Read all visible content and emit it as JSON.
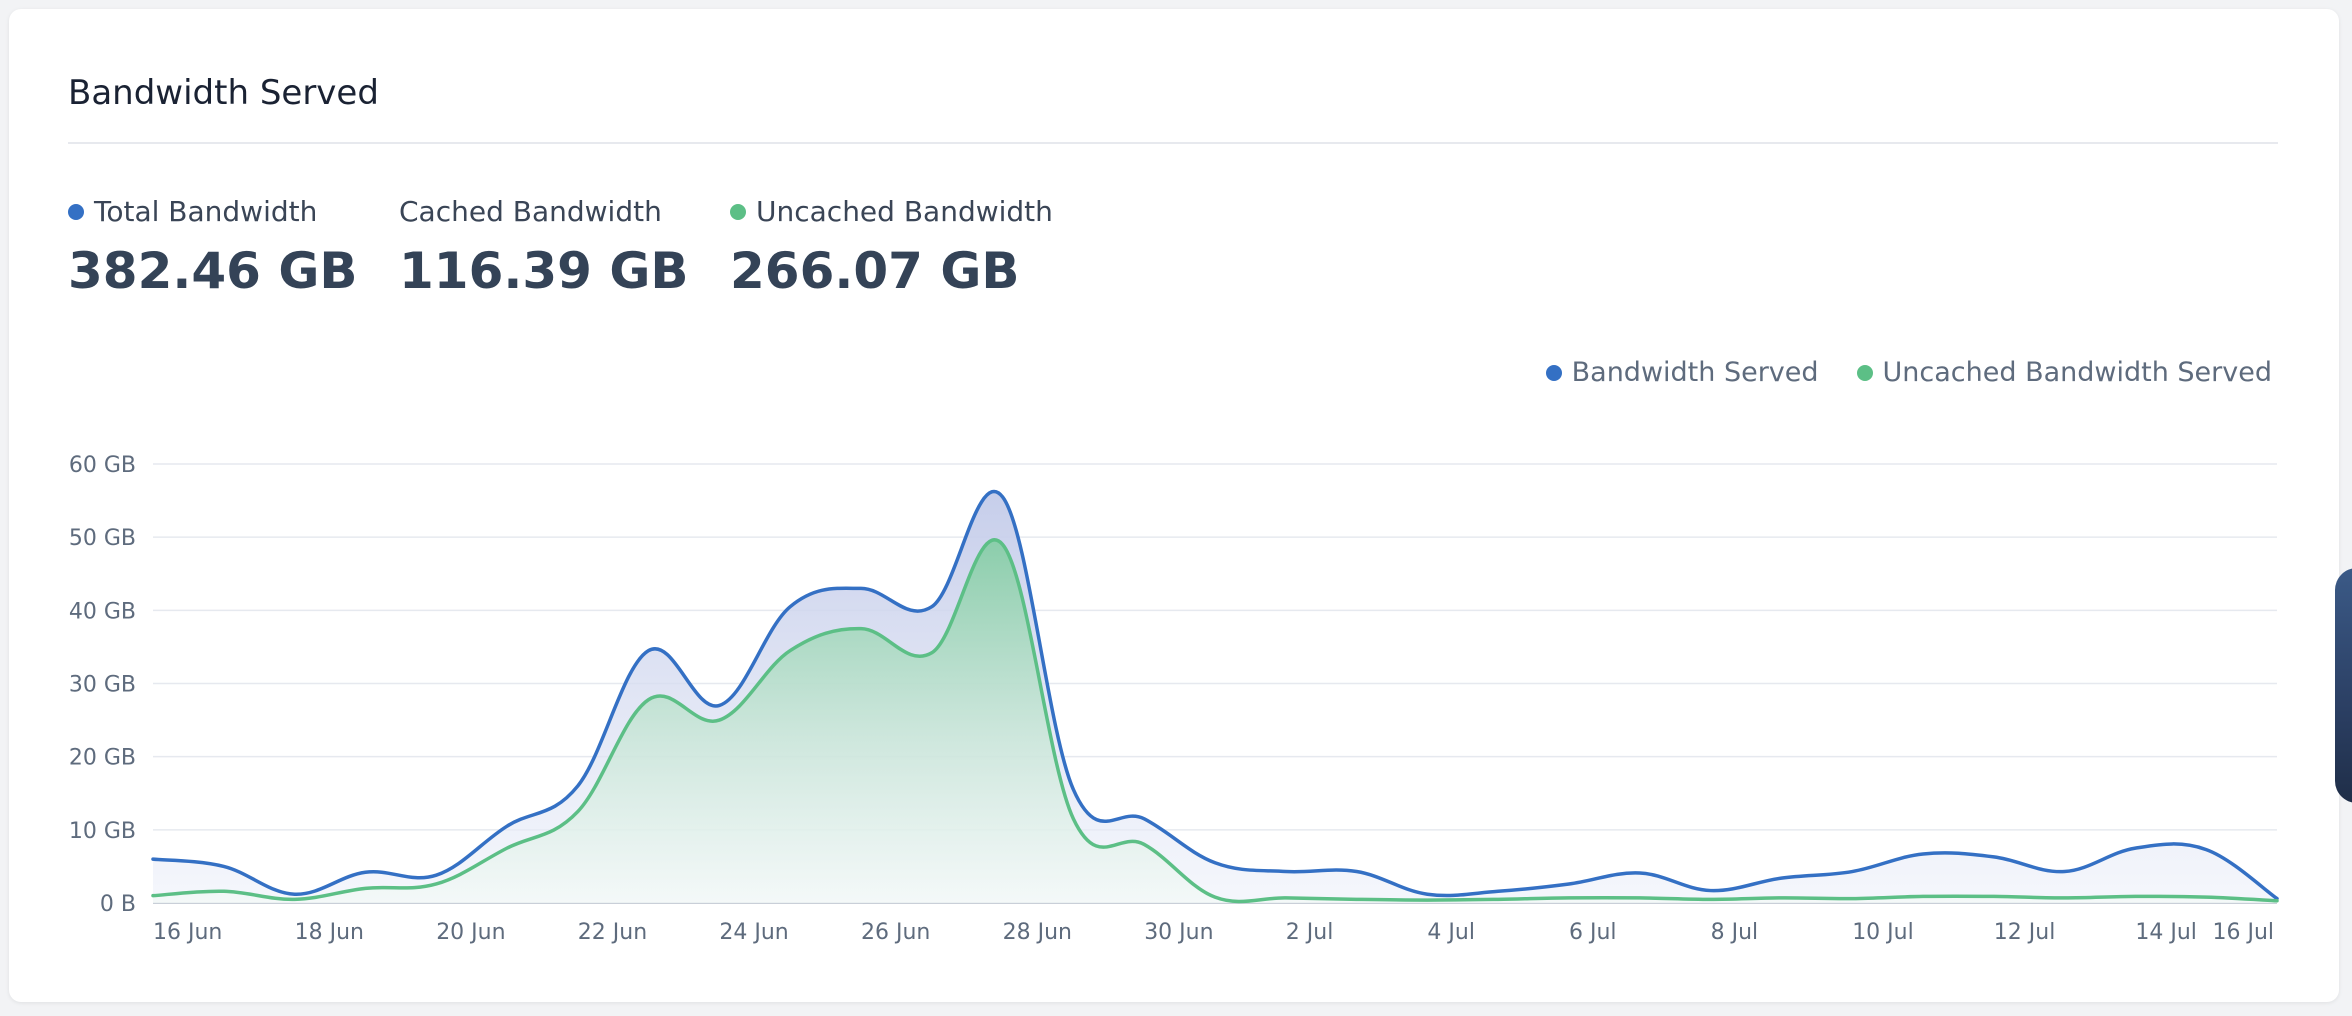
{
  "card": {
    "title": "Bandwidth Served"
  },
  "stats": [
    {
      "label": "Total Bandwidth",
      "value": "382.46 GB",
      "dot_color": "#3470c4",
      "has_dot": true
    },
    {
      "label": "Cached Bandwidth",
      "value": "116.39 GB",
      "dot_color": "",
      "has_dot": false
    },
    {
      "label": "Uncached Bandwidth",
      "value": "266.07 GB",
      "dot_color": "#5cbf86",
      "has_dot": true
    }
  ],
  "legend": [
    {
      "label": "Bandwidth Served",
      "color": "#3470c4"
    },
    {
      "label": "Uncached Bandwidth Served",
      "color": "#5cbf86"
    }
  ],
  "colors": {
    "total_line": "#3470c4",
    "uncached_line": "#5cbf86",
    "total_fill": "#c9d1ec",
    "uncached_fill": "#5cbf86"
  },
  "chart_data": {
    "type": "area",
    "title": "Bandwidth Served",
    "xlabel": "",
    "ylabel": "",
    "ylim": [
      0,
      60
    ],
    "y_unit": "GB",
    "y_ticks": [
      {
        "value": 0,
        "label": "0 B"
      },
      {
        "value": 10,
        "label": "10 GB"
      },
      {
        "value": 20,
        "label": "20 GB"
      },
      {
        "value": 30,
        "label": "30 GB"
      },
      {
        "value": 40,
        "label": "40 GB"
      },
      {
        "value": 50,
        "label": "50 GB"
      },
      {
        "value": 60,
        "label": "60 GB"
      }
    ],
    "x": [
      "16 Jun",
      "17 Jun",
      "18 Jun",
      "19 Jun",
      "20 Jun",
      "21 Jun",
      "22 Jun",
      "23 Jun",
      "24 Jun",
      "25 Jun",
      "26 Jun",
      "27 Jun",
      "28 Jun",
      "29 Jun",
      "30 Jun",
      "1 Jul",
      "2 Jul",
      "3 Jul",
      "4 Jul",
      "5 Jul",
      "6 Jul",
      "7 Jul",
      "8 Jul",
      "9 Jul",
      "10 Jul",
      "11 Jul",
      "12 Jul",
      "13 Jul",
      "14 Jul",
      "15 Jul",
      "16 Jul"
    ],
    "x_tick_labels": [
      "16 Jun",
      "18 Jun",
      "20 Jun",
      "22 Jun",
      "24 Jun",
      "26 Jun",
      "28 Jun",
      "30 Jun",
      "2 Jul",
      "4 Jul",
      "6 Jul",
      "8 Jul",
      "10 Jul",
      "12 Jul",
      "14 Jul",
      "16 Jul"
    ],
    "grid": true,
    "legend_position": "top-right",
    "series": [
      {
        "name": "Bandwidth Served",
        "values": [
          6.0,
          5.0,
          1.2,
          4.2,
          3.8,
          10.5,
          16.0,
          34.5,
          27.0,
          40.5,
          43.0,
          40.5,
          55.5,
          15.5,
          11.5,
          5.5,
          4.3,
          4.3,
          1.2,
          1.6,
          2.6,
          4.1,
          1.7,
          3.4,
          4.3,
          6.7,
          6.3,
          4.3,
          7.5,
          7.3,
          0.6
        ]
      },
      {
        "name": "Uncached Bandwidth Served",
        "values": [
          1.0,
          1.6,
          0.5,
          2.0,
          2.6,
          7.5,
          12.5,
          27.8,
          25.0,
          34.5,
          37.5,
          34.2,
          49.0,
          11.5,
          8.0,
          0.8,
          0.7,
          0.5,
          0.4,
          0.5,
          0.7,
          0.7,
          0.5,
          0.7,
          0.6,
          0.9,
          0.9,
          0.7,
          0.9,
          0.8,
          0.3
        ]
      }
    ]
  }
}
